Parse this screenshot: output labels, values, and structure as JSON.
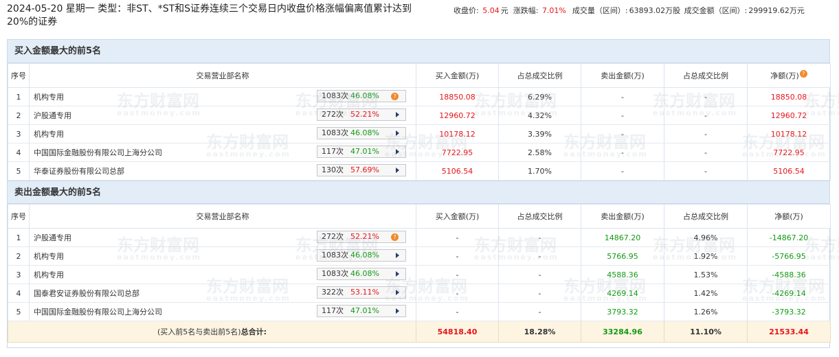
{
  "header": {
    "title": "2024-05-20 星期一 类型：非ST、*ST和S证券连续三个交易日内收盘价格涨幅偏离值累计达到20%的证券",
    "close_label": "收盘价:",
    "close_value": "5.04",
    "close_unit": "元",
    "change_label": "涨跌幅:",
    "change_value": "7.01%",
    "volume_label": "成交量（区间）:",
    "volume_value": "63893.02万股",
    "amount_label": "成交金额（区间）:",
    "amount_value": "299919.62万元"
  },
  "watermark": {
    "cn": "东方财富网",
    "en": "eastmoney.com"
  },
  "buy": {
    "section_title": "买入金额最大的前5名",
    "headers": [
      "序号",
      "交易营业部名称",
      "买入金额(万)",
      "占总成交比例",
      "卖出金额(万)",
      "占总成交比例",
      "净额(万)"
    ],
    "rows": [
      {
        "idx": "1",
        "name": "机构专用",
        "count": "1083次",
        "rate": "46.08%",
        "rate_color": "green",
        "icon": "help",
        "buy": "18850.08",
        "buy_pct": "6.29%",
        "sell": "-",
        "sell_pct": "-",
        "net": "18850.08"
      },
      {
        "idx": "2",
        "name": "沪股通专用",
        "count": "272次",
        "rate": "52.21%",
        "rate_color": "red",
        "icon": "arrow",
        "buy": "12960.72",
        "buy_pct": "4.32%",
        "sell": "-",
        "sell_pct": "-",
        "net": "12960.72"
      },
      {
        "idx": "3",
        "name": "机构专用",
        "count": "1083次",
        "rate": "46.08%",
        "rate_color": "green",
        "icon": "arrow",
        "buy": "10178.12",
        "buy_pct": "3.39%",
        "sell": "-",
        "sell_pct": "-",
        "net": "10178.12"
      },
      {
        "idx": "4",
        "name": "中国国际金融股份有限公司上海分公司",
        "count": "117次",
        "rate": "47.01%",
        "rate_color": "green",
        "icon": "arrow",
        "buy": "7722.95",
        "buy_pct": "2.58%",
        "sell": "-",
        "sell_pct": "-",
        "net": "7722.95"
      },
      {
        "idx": "5",
        "name": "华泰证券股份有限公司总部",
        "count": "130次",
        "rate": "57.69%",
        "rate_color": "red",
        "icon": "arrow",
        "buy": "5106.54",
        "buy_pct": "1.70%",
        "sell": "-",
        "sell_pct": "-",
        "net": "5106.54"
      }
    ]
  },
  "sell": {
    "section_title": "卖出金额最大的前5名",
    "headers": [
      "序号",
      "交易营业部名称",
      "买入金额(万)",
      "占总成交比例",
      "卖出金额(万)",
      "占总成交比例",
      "净额(万)"
    ],
    "rows": [
      {
        "idx": "1",
        "name": "沪股通专用",
        "count": "272次",
        "rate": "52.21%",
        "rate_color": "red",
        "icon": "help",
        "buy": "-",
        "buy_pct": "-",
        "sell": "14867.20",
        "sell_pct": "4.96%",
        "net": "-14867.20"
      },
      {
        "idx": "2",
        "name": "机构专用",
        "count": "1083次",
        "rate": "46.08%",
        "rate_color": "green",
        "icon": "arrow",
        "buy": "-",
        "buy_pct": "-",
        "sell": "5766.95",
        "sell_pct": "1.92%",
        "net": "-5766.95"
      },
      {
        "idx": "3",
        "name": "机构专用",
        "count": "1083次",
        "rate": "46.08%",
        "rate_color": "green",
        "icon": "arrow",
        "buy": "-",
        "buy_pct": "-",
        "sell": "4588.36",
        "sell_pct": "1.53%",
        "net": "-4588.36"
      },
      {
        "idx": "4",
        "name": "国泰君安证券股份有限公司总部",
        "count": "322次",
        "rate": "53.11%",
        "rate_color": "red",
        "icon": "arrow",
        "buy": "-",
        "buy_pct": "-",
        "sell": "4269.14",
        "sell_pct": "1.42%",
        "net": "-4269.14"
      },
      {
        "idx": "5",
        "name": "中国国际金融股份有限公司上海分公司",
        "count": "117次",
        "rate": "47.01%",
        "rate_color": "green",
        "icon": "arrow",
        "buy": "-",
        "buy_pct": "-",
        "sell": "3793.32",
        "sell_pct": "1.26%",
        "net": "-3793.32"
      }
    ]
  },
  "total": {
    "label_prefix": "(买入前5名与卖出前5名)",
    "label_bold": "总合计:",
    "buy": "54818.40",
    "buy_pct": "18.28%",
    "sell": "33284.96",
    "sell_pct": "11.10%",
    "net": "21533.44"
  },
  "colors": {
    "red": "#e8141a",
    "green": "#119a13",
    "section_bg": "#e3edf8",
    "total_bg": "#fdf5e2",
    "help_icon": "#f08a2a"
  }
}
